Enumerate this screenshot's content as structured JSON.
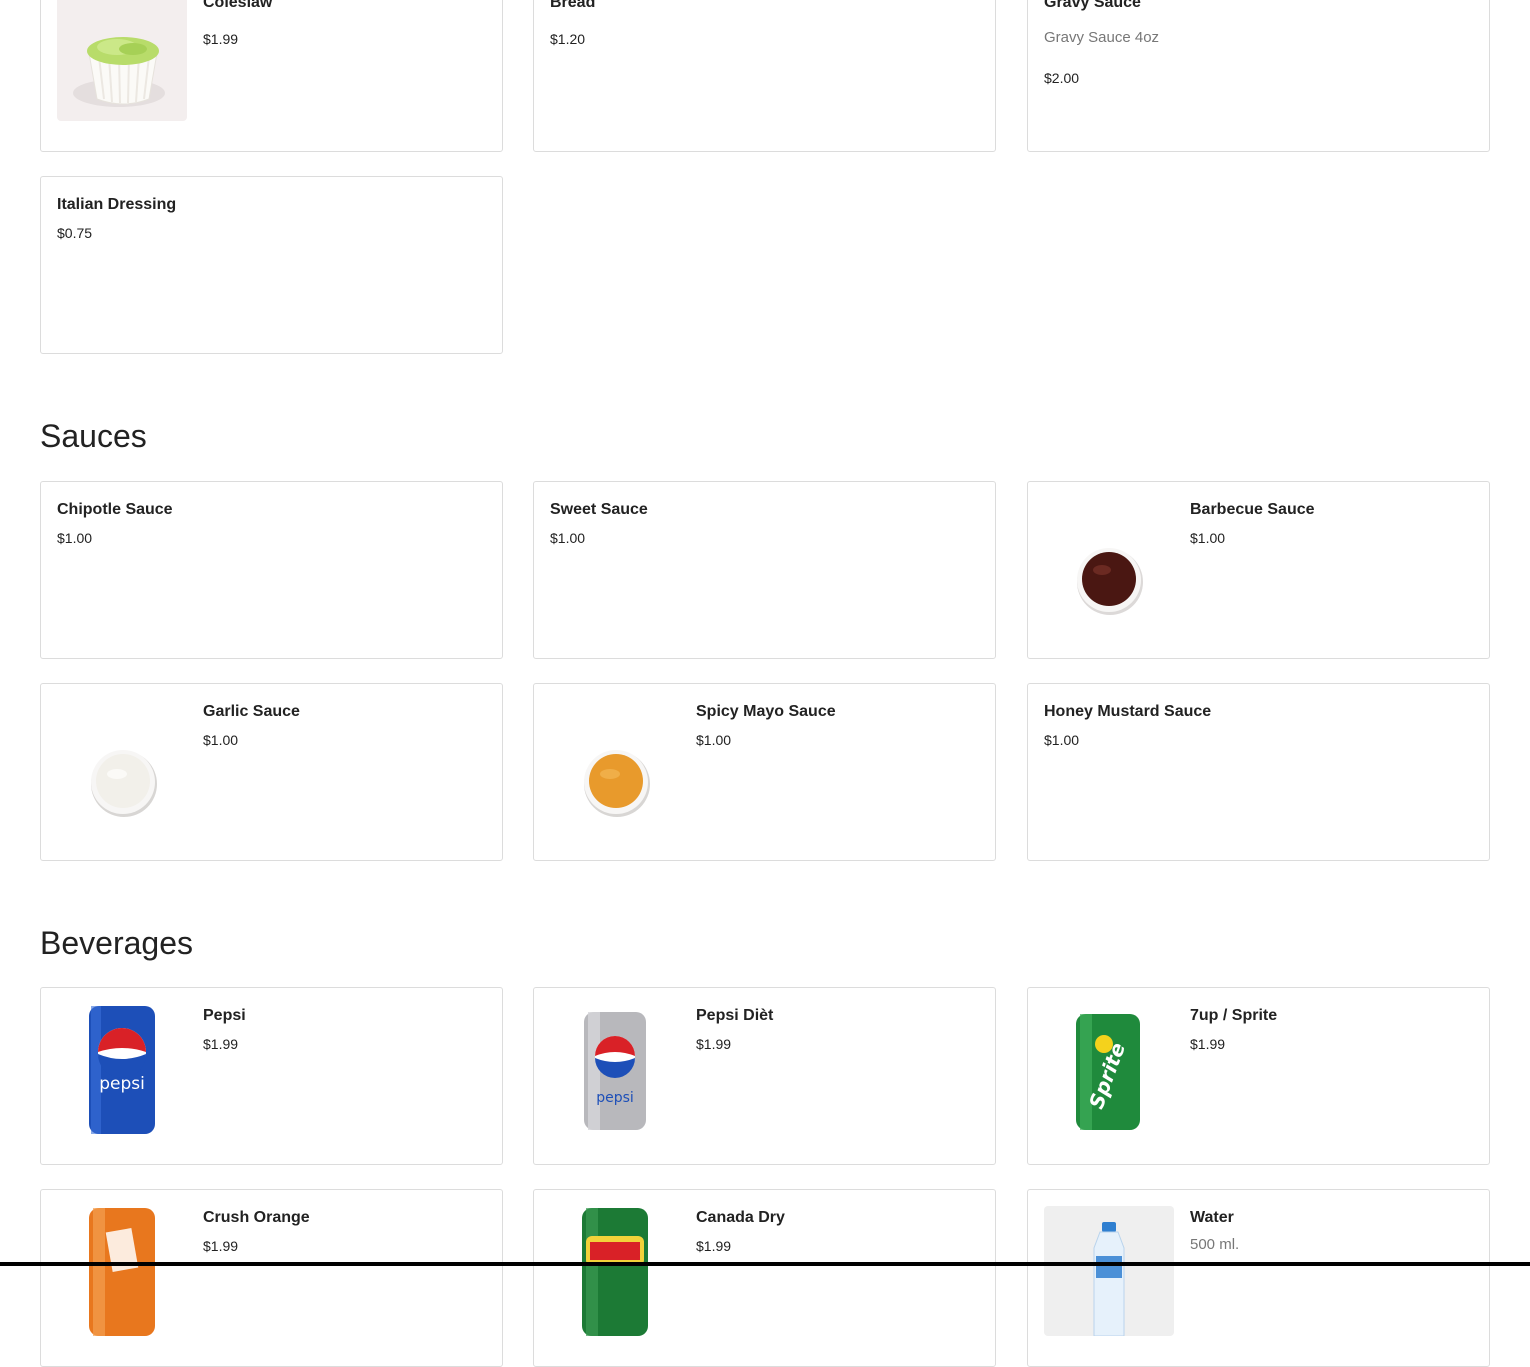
{
  "sections": {
    "top_items": [
      {
        "name": "Coleslaw",
        "price": "$1.99"
      },
      {
        "name": "Bread",
        "price": "$1.20"
      },
      {
        "name": "Gravy Sauce",
        "description": "Gravy Sauce 4oz",
        "price": "$2.00"
      },
      {
        "name": "Italian Dressing",
        "price": "$0.75"
      }
    ],
    "sauces": {
      "title": "Sauces",
      "items": [
        {
          "name": "Chipotle Sauce",
          "price": "$1.00"
        },
        {
          "name": "Sweet Sauce",
          "price": "$1.00"
        },
        {
          "name": "Barbecue Sauce",
          "price": "$1.00",
          "image": "barbecue-sauce-cup",
          "color": "#4a1712"
        },
        {
          "name": "Garlic Sauce",
          "price": "$1.00",
          "image": "garlic-sauce-cup",
          "color": "#f2f0ea"
        },
        {
          "name": "Spicy Mayo Sauce",
          "price": "$1.00",
          "image": "spicy-mayo-cup",
          "color": "#e89a2c"
        },
        {
          "name": "Honey Mustard Sauce",
          "price": "$1.00"
        }
      ]
    },
    "beverages": {
      "title": "Beverages",
      "items": [
        {
          "name": "Pepsi",
          "price": "$1.99",
          "image": "pepsi-can",
          "color": "#1d4fb8"
        },
        {
          "name": "Pepsi Dièt",
          "price": "$1.99",
          "image": "diet-pepsi-can",
          "color": "#b8b8bc"
        },
        {
          "name": "7up / Sprite",
          "price": "$1.99",
          "image": "sprite-can",
          "color": "#1f8a3c"
        },
        {
          "name": "Crush Orange",
          "price": "$1.99",
          "image": "crush-orange-can",
          "color": "#e8771e"
        },
        {
          "name": "Canada Dry",
          "price": "$1.99",
          "image": "canada-dry-can",
          "color": "#1c7a35"
        },
        {
          "name": "Water",
          "description": "500 ml.",
          "image": "water-bottle",
          "color": "#2f7fd0"
        }
      ]
    }
  }
}
